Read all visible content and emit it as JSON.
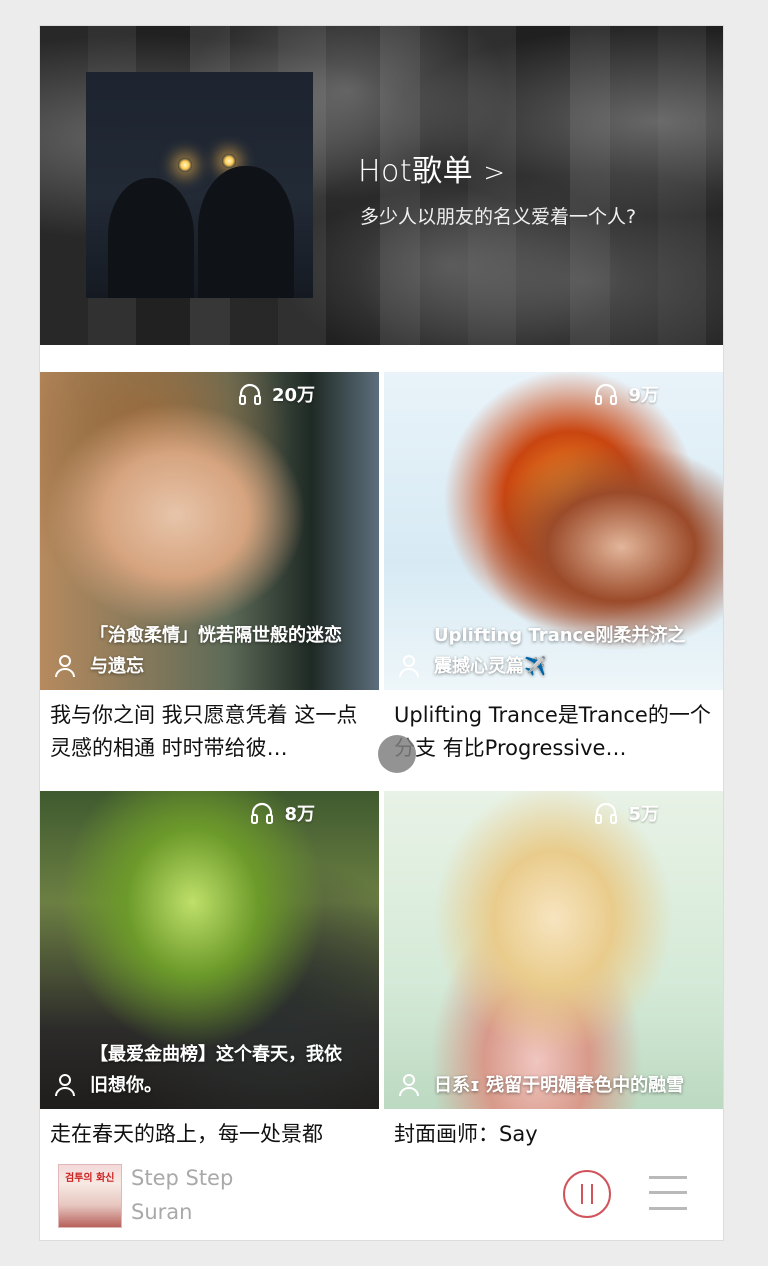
{
  "hero": {
    "title": "Hot歌单",
    "arrow": ">",
    "subtitle": "多少人以朋友的名义爱着一个人?"
  },
  "cards": [
    {
      "plays": "20万",
      "caption": "「治愈柔情」恍若隔世般的迷恋与遗忘",
      "description": "我与你之间 我只愿意凭着 这一点灵感的相通 时时带给彼…"
    },
    {
      "plays": "9万",
      "caption": "Uplifting Trance刚柔并济之震撼心灵篇✈️",
      "description": "Uplifting Trance是Trance的一个分支 有比Progressive…"
    },
    {
      "plays": "8万",
      "caption": "【最爱金曲榜】这个春天，我依旧想你。",
      "description": "走在春天的路上，每一处景都"
    },
    {
      "plays": "5万",
      "caption": "日系ɪ 残留于明媚春色中的融雪",
      "description": "封面画师：Say"
    }
  ],
  "player": {
    "song": "Step Step",
    "artist": "Suran",
    "cover_badge": "검투의 화신",
    "accent_color": "#d1545d"
  },
  "icons": {
    "play_count": "headphones-icon",
    "creator": "user-icon",
    "pause": "pause-icon",
    "menu": "menu-icon"
  }
}
